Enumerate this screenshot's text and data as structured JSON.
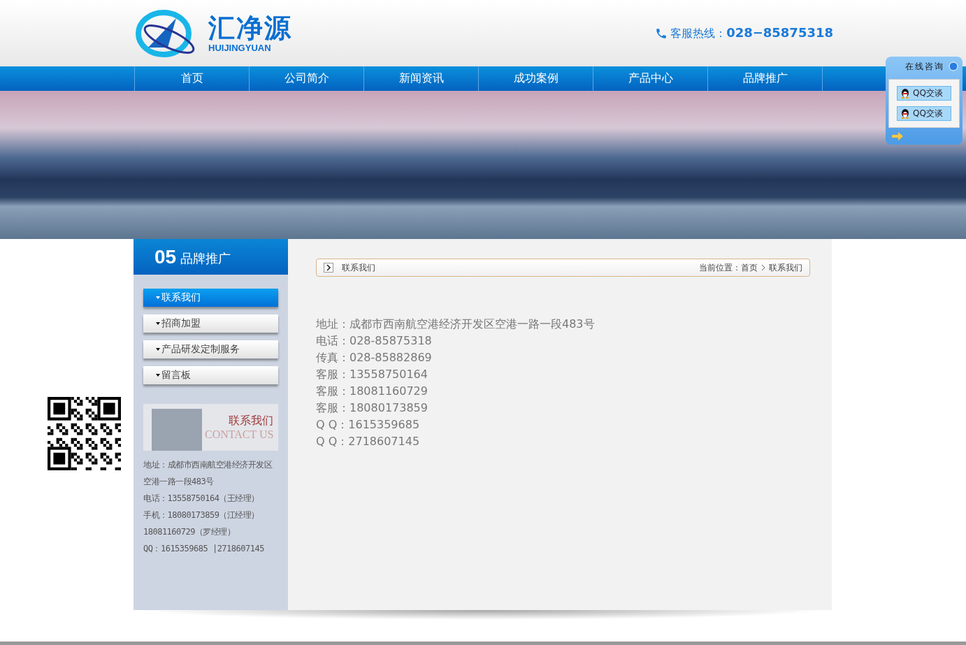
{
  "header": {
    "logo_cn": "汇净源",
    "logo_en": "HUIJINGYUAN",
    "hotline": "客服热线：**028−85875318**"
  },
  "nav": [
    {
      "label": "首页"
    },
    {
      "label": "公司简介"
    },
    {
      "label": "新闻资讯"
    },
    {
      "label": "成功案例"
    },
    {
      "label": "产品中心"
    },
    {
      "label": "品牌推广"
    }
  ],
  "chat_widget": {
    "title": "在线咨询",
    "buttons": [
      "QQ交谈",
      "QQ交谈"
    ]
  },
  "sidebar": {
    "number": "05",
    "title": "品牌推广",
    "items": [
      {
        "label": "联系我们",
        "selected": true
      },
      {
        "label": "招商加盟",
        "selected": false
      },
      {
        "label": "产品研发定制服务",
        "selected": false
      },
      {
        "label": "留言板",
        "selected": false
      }
    ],
    "contact_banner": {
      "title": "联系我们",
      "subtitle": "CONTACT US"
    },
    "contact_lines": [
      "地址：成都市西南航空港经济开发区空港一路一段483号",
      "电话：13558750164（王经理）",
      "手机：18080173859（江经理）",
      "18081160729（罗经理）",
      "QQ：1615359685 |2718607145"
    ]
  },
  "breadcrumb": {
    "title": "联系我们",
    "location_label": "当前位置：",
    "path": [
      "首页",
      "联系我们"
    ]
  },
  "content_lines": [
    "地址：成都市西南航空港经济开发区空港一路一段483号",
    "电话：028-85875318",
    "传真：028-85882869",
    "客服：13558750164",
    "客服：18081160729",
    "客服：18080173859",
    "Q Q：1615359685",
    "Q Q：2718607145"
  ]
}
